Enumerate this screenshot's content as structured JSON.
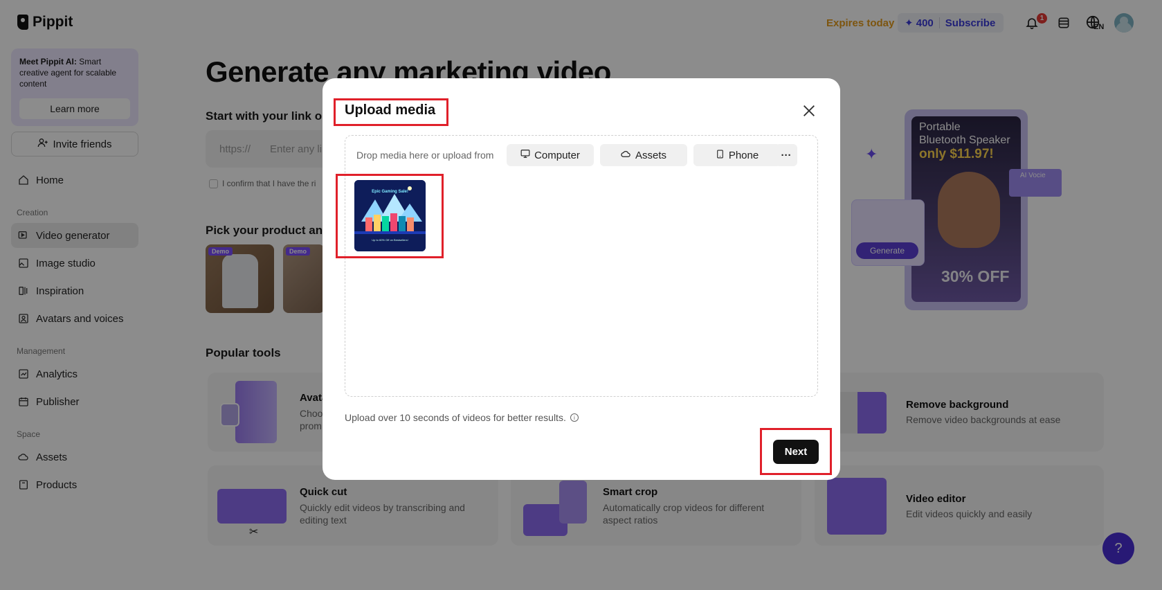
{
  "header": {
    "logo": "Pippit",
    "expires": "Expires today",
    "credits": "400",
    "subscribe": "Subscribe",
    "notification_count": "1",
    "lang": "EN"
  },
  "sidebar": {
    "promo_title": "Meet Pippit AI:",
    "promo_text": " Smart creative agent for scalable content",
    "learn_more": "Learn more",
    "invite": "Invite friends",
    "home": "Home",
    "section_creation": "Creation",
    "items_creation": [
      "Video generator",
      "Image studio",
      "Inspiration",
      "Avatars and voices"
    ],
    "section_management": "Management",
    "items_management": [
      "Analytics",
      "Publisher"
    ],
    "section_space": "Space",
    "items_space": [
      "Assets",
      "Products"
    ]
  },
  "main": {
    "headline": "Generate any marketing video",
    "link_heading": "Start with your link or",
    "link_prefix": "https://",
    "link_placeholder": "Enter any li",
    "confirm": "I confirm that I have the ri",
    "pick_heading": "Pick your product and",
    "demo_tag": "Demo",
    "popular_heading": "Popular tools",
    "tools": [
      {
        "title": "Avata",
        "desc": "Choo\nprom"
      },
      {
        "title": "Remove background",
        "desc": "Remove video backgrounds at ease"
      },
      {
        "title": "Quick cut",
        "desc": "Quickly edit videos by transcribing and editing text"
      },
      {
        "title": "Smart crop",
        "desc": "Automatically crop videos for different aspect ratios"
      },
      {
        "title": "Video editor",
        "desc": "Edit videos quickly and easily"
      }
    ],
    "hero": {
      "line1": "Portable",
      "line2": "Bluetooth Speaker",
      "price": "only $11.97!",
      "discount": "30% OFF",
      "generate": "Generate",
      "ai_voice": "AI Vocie"
    }
  },
  "modal": {
    "title": "Upload media",
    "drop_text": "Drop media here or upload from",
    "sources": [
      "Computer",
      "Assets",
      "Phone"
    ],
    "more": "···",
    "thumb_title": "Epic Gaming Sale!",
    "thumb_sub": "Up to 60% Off on Bestsellers!",
    "note": "Upload over 10 seconds of videos for better results.",
    "next": "Next"
  },
  "colors": {
    "accent": "#5b3fd6",
    "highlight": "#e0202a",
    "expires": "#e39b1c"
  }
}
